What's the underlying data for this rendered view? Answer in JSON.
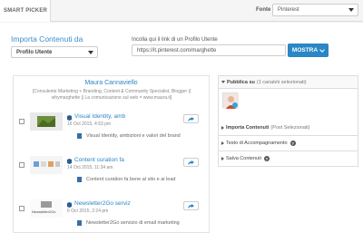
{
  "header": {
    "tab_label": "SMART PICKER",
    "fonte_label": "Fonte",
    "fonte_value": "Pinterest"
  },
  "import": {
    "title": "Importa Contenuti da",
    "profile_select": "Profilo Utente",
    "url_label": "Incolla qui il link di un Profilo Utente",
    "url_value": "https://it.pinterest.com/marghette",
    "mostra_label": "MOSTRA"
  },
  "profile": {
    "name": "Maura Cannaviello",
    "desc_line1": "[Consulente Marketing + Branding, Content & Community Specialist, Blogger ||",
    "desc_line2": "whymarghette || La comunicazione sul web = www.maura.it]"
  },
  "items": [
    {
      "title": "Visual Identity, amb",
      "date": "16 Oct 2015, 4:53 pm",
      "desc": "Visual Identity, ambizioni e valori del brand"
    },
    {
      "title": "Content curation fa",
      "date": "14 Oct 2015, 11:34 am",
      "desc": "Content curation fa bene al sito e ai lead"
    },
    {
      "title": "Newsletter2Go serviz",
      "date": "6 Oct 2015, 2:24 pm",
      "desc": "Newsletter2Go servizio di email marketing",
      "thumb_text": "Newsletter2Go"
    }
  ],
  "right_panel": {
    "publish_bold": "Pubblica su",
    "publish_rest": "(1 canale\\i selezionati)",
    "import_bold": "Importa Contenuti",
    "import_rest": "(Post Selezionati)",
    "testo": "Testo di Accompagnamento",
    "salva": "Salva Contenuti",
    "help_glyph": "?"
  },
  "colors": {
    "accent": "#2a86c5",
    "twitter": "#2aa6e0"
  }
}
